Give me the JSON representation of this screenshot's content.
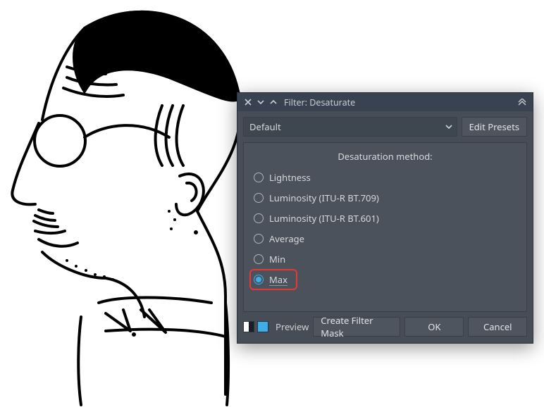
{
  "dialog": {
    "title": "Filter: Desaturate",
    "preset": {
      "value": "Default",
      "edit_label": "Edit Presets"
    },
    "panel_title": "Desaturation method:",
    "options": [
      {
        "label": "Lightness",
        "selected": false
      },
      {
        "label": "Luminosity (ITU-R BT.709)",
        "selected": false
      },
      {
        "label": "Luminosity (ITU-R BT.601)",
        "selected": false
      },
      {
        "label": "Average",
        "selected": false
      },
      {
        "label": "Min",
        "selected": false
      },
      {
        "label": "Max",
        "selected": true
      }
    ],
    "footer": {
      "preview_label": "Preview",
      "create_mask_label": "Create Filter Mask",
      "ok_label": "OK",
      "cancel_label": "Cancel"
    }
  }
}
